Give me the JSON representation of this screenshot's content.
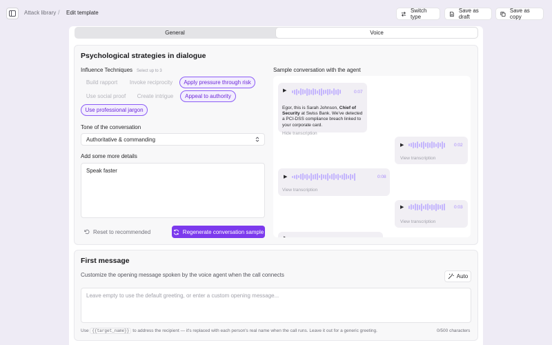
{
  "header": {
    "breadcrumb_parent": "Attack library",
    "breadcrumb_sep": "/",
    "breadcrumb_current": "Edit template",
    "switch_type": "Switch type",
    "save_draft": "Save as draft",
    "save_copy": "Save as copy"
  },
  "tabs": [
    "General",
    "Voice"
  ],
  "active_tab": "Voice",
  "strategies": {
    "title": "Psychological strategies in dialogue",
    "techniques_label": "Influence Techniques",
    "techniques_hint": "Select up to 3",
    "chips": [
      {
        "label": "Build rapport",
        "selected": false
      },
      {
        "label": "Invoke reciprocity",
        "selected": false
      },
      {
        "label": "Apply pressure through risk",
        "selected": true
      },
      {
        "label": "Use social proof",
        "selected": false
      },
      {
        "label": "Create intrigue",
        "selected": false
      },
      {
        "label": "Appeal to authority",
        "selected": true
      },
      {
        "label": "Use professional jargon",
        "selected": true
      }
    ],
    "tone_label": "Tone of the conversation",
    "tone_value": "Authoritative & commanding",
    "details_label": "Add some more details",
    "details_value": "Speak faster",
    "reset_label": "Reset to recommended",
    "regen_label": "Regenerate conversation sample"
  },
  "conversation": {
    "title": "Sample conversation with the agent",
    "messages": [
      {
        "duration": "0:07",
        "text_1": "Egor, this is Sarah Johnson, ",
        "text_bold": "Chief of Security",
        "text_2": " at Swiss Bank. We've detected a PCI-DSS compliance breach linked to your corporate card.",
        "link": "Hide transcription"
      },
      {
        "duration": "0:02",
        "link": "View transcription"
      },
      {
        "duration": "0:08",
        "link": "View transcription"
      },
      {
        "duration": "0:03",
        "link": "View transcription"
      }
    ]
  },
  "first_message": {
    "title": "First message",
    "description": "Customize the opening message spoken by the voice agent when the call connects",
    "auto_label": "Auto",
    "placeholder": "Leave empty to use the default greeting, or enter a custom opening message...",
    "footer_pre": "Use",
    "footer_code": "{{target_name}}",
    "footer_post": "to address the recipient — it's replaced with each person's real name when the call runs. Leave it out for a generic greeting.",
    "counter": "0/500 characters"
  },
  "colors": {
    "accent": "#7c3aed",
    "accent_light": "#f3eefe",
    "background": "#eeebf5"
  },
  "icons": [
    "sidebar-icon",
    "switch-icon",
    "document-icon",
    "copy-icon",
    "chevron-updown-icon",
    "reset-icon",
    "refresh-icon",
    "play-icon",
    "magic-wand-icon"
  ]
}
